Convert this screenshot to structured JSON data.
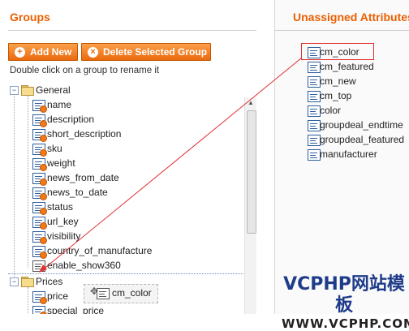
{
  "left_panel": {
    "title": "Groups",
    "buttons": {
      "add_new": "Add New",
      "delete_group": "Delete Selected Group"
    },
    "hint": "Double click on a group to rename it",
    "groups": [
      {
        "name": "General",
        "expanded": true,
        "attributes": [
          "name",
          "description",
          "short_description",
          "sku",
          "weight",
          "news_from_date",
          "news_to_date",
          "status",
          "url_key",
          "visibility",
          "country_of_manufacture",
          "enable_show360"
        ]
      },
      {
        "name": "Prices",
        "expanded": true,
        "attributes": [
          "price",
          "special_price"
        ]
      }
    ]
  },
  "right_panel": {
    "title": "Unassigned Attributes",
    "attributes": [
      "cm_color",
      "cm_featured",
      "cm_new",
      "cm_top",
      "color",
      "groupdeal_endtime",
      "groupdeal_featured",
      "manufacturer"
    ]
  },
  "drag": {
    "dragged_attribute": "cm_color",
    "ghost_label": "cm_color"
  },
  "watermark": {
    "line1": "VCPHP网站模板",
    "line2": "WWW.VCPHP.COM"
  },
  "colors": {
    "accent": "#eb5e00",
    "button": "#f07a1a",
    "annotation": "#e03030",
    "attribute_icon": "#2e5f9f"
  },
  "icons": {
    "add": "plus-circle-icon",
    "delete": "x-circle-icon",
    "group": "folder-icon",
    "attribute": "attribute-icon"
  }
}
